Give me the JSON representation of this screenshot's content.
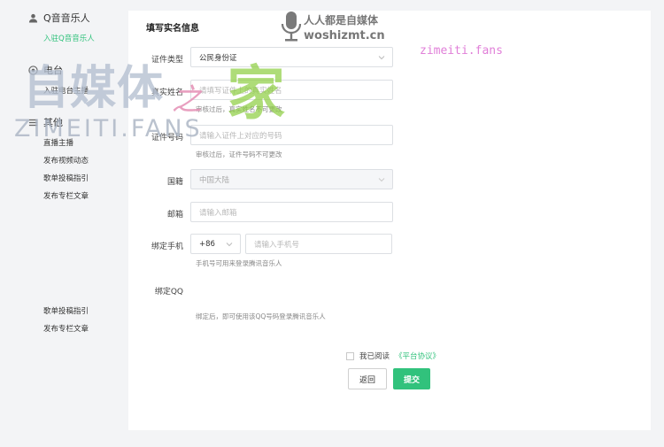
{
  "sidebar": {
    "groups": [
      {
        "icon": "person-icon",
        "label": "Q音音乐人",
        "items": [
          "入驻Q音音乐人"
        ]
      },
      {
        "icon": "radio-icon",
        "label": "电台",
        "items": [
          "入驻电台主播"
        ]
      },
      {
        "icon": "menu-icon",
        "label": "其他",
        "items": [
          "直播主播",
          "发布视频动态",
          "歌单投稿指引",
          "发布专栏文章"
        ]
      }
    ],
    "bottom_items": [
      "歌单投稿指引",
      "发布专栏文章"
    ],
    "active_item": "入驻Q音音乐人"
  },
  "form": {
    "title": "填写实名信息",
    "id_type": {
      "label": "证件类型",
      "value": "公民身份证"
    },
    "real_name": {
      "label": "真实姓名",
      "placeholder": "请填写证件上的真实姓名",
      "hint": "审核过后，真实姓名不可更改"
    },
    "id_number": {
      "label": "证件号码",
      "placeholder": "请输入证件上对应的号码",
      "hint": "审核过后，证件号码不可更改"
    },
    "country": {
      "label": "国籍",
      "value": "中国大陆"
    },
    "email": {
      "label": "邮箱",
      "placeholder": "请输入邮箱"
    },
    "phone": {
      "label": "绑定手机",
      "country_code": "+86",
      "placeholder": "请输入手机号",
      "hint": "手机号可用来登录腾讯音乐人"
    },
    "qq": {
      "label": "绑定QQ",
      "hint": "绑定后，即可使用该QQ号码登录腾讯音乐人"
    },
    "agreement": {
      "prefix": "我已阅读",
      "link": "《平台协议》",
      "checked": false
    },
    "back_label": "返回",
    "submit_label": "提交"
  },
  "watermarks": {
    "logo_cn": "自媒体",
    "logo_zhi": "之",
    "logo_jia": "家",
    "logo_en": "ZIMEITI.FANS",
    "site_cn": "人人都是自媒体",
    "site_url": "woshizmt.cn",
    "pink_url": "zimeiti.fans"
  },
  "colors": {
    "accent": "#31c27c",
    "panel": "#ffffff",
    "background": "#f3f4f6"
  }
}
